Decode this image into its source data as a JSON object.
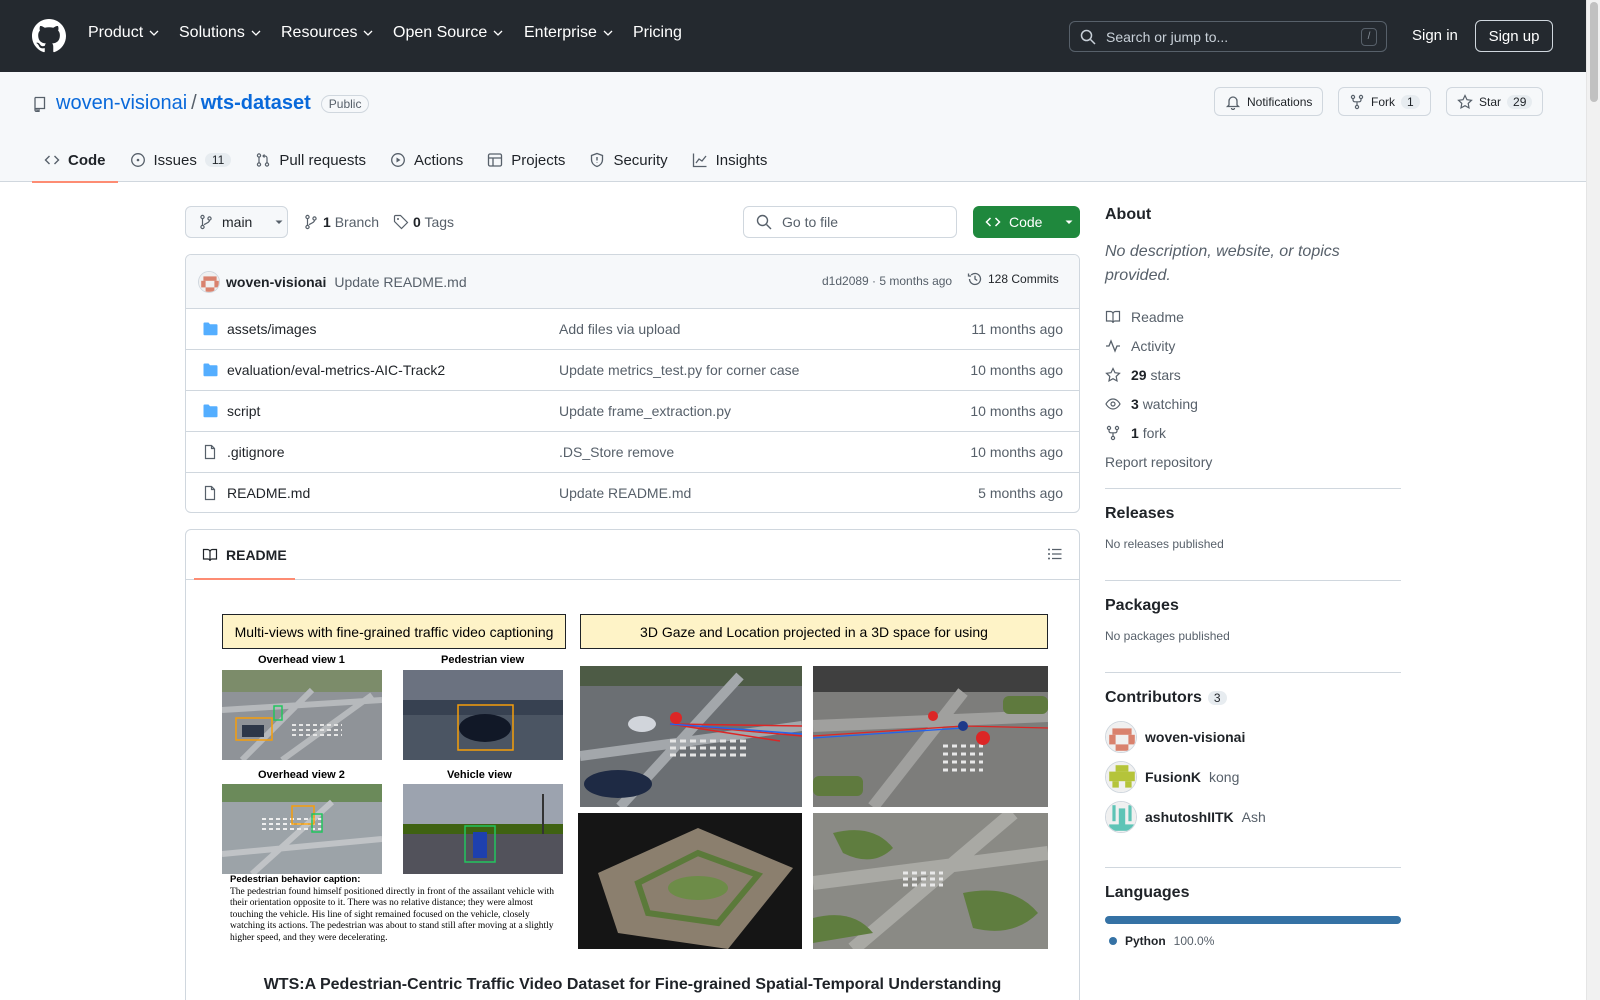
{
  "header": {
    "nav": [
      {
        "label": "Product",
        "dropdown": true
      },
      {
        "label": "Solutions",
        "dropdown": true
      },
      {
        "label": "Resources",
        "dropdown": true
      },
      {
        "label": "Open Source",
        "dropdown": true
      },
      {
        "label": "Enterprise",
        "dropdown": true
      },
      {
        "label": "Pricing",
        "dropdown": false
      }
    ],
    "search_placeholder": "Search or jump to...",
    "search_shortcut": "/",
    "signin": "Sign in",
    "signup": "Sign up"
  },
  "repo": {
    "owner": "woven-visionai",
    "separator": "/",
    "name": "wts-dataset",
    "visibility": "Public",
    "notifications_label": "Notifications",
    "fork_label": "Fork",
    "fork_count": "1",
    "star_label": "Star",
    "star_count": "29"
  },
  "tabs": [
    {
      "label": "Code",
      "icon": "code-icon",
      "active": true
    },
    {
      "label": "Issues",
      "icon": "issue-icon",
      "count": "11"
    },
    {
      "label": "Pull requests",
      "icon": "pull-request-icon"
    },
    {
      "label": "Actions",
      "icon": "play-icon"
    },
    {
      "label": "Projects",
      "icon": "table-icon"
    },
    {
      "label": "Security",
      "icon": "shield-icon"
    },
    {
      "label": "Insights",
      "icon": "graph-icon"
    }
  ],
  "toolbar": {
    "branch": "main",
    "branch_count": "1",
    "branch_label": "Branch",
    "tag_count": "0",
    "tag_label": "Tags",
    "goto_placeholder": "Go to file",
    "code_button": "Code"
  },
  "latest_commit": {
    "author": "woven-visionai",
    "message": "Update README.md",
    "sha_age": "d1d2089 · 5 months ago",
    "commits": "128 Commits"
  },
  "files": [
    {
      "type": "dir",
      "name": "assets/images",
      "message": "Add files via upload",
      "age": "11 months ago"
    },
    {
      "type": "dir",
      "name": "evaluation/eval-metrics-AIC-Track2",
      "message": "Update metrics_test.py for corner case",
      "age": "10 months ago"
    },
    {
      "type": "dir",
      "name": "script",
      "message": "Update frame_extraction.py",
      "age": "10 months ago"
    },
    {
      "type": "file",
      "name": ".gitignore",
      "message": ".DS_Store remove",
      "age": "10 months ago"
    },
    {
      "type": "file",
      "name": "README.md",
      "message": "Update README.md",
      "age": "5 months ago"
    }
  ],
  "readme": {
    "tab_label": "README",
    "figure": {
      "left_caption": "Multi-views with fine-grained traffic video captioning",
      "right_caption": "3D Gaze and Location projected in a 3D space for using",
      "views": [
        "Overhead view 1",
        "Pedestrian view",
        "Overhead view 2",
        "Vehicle view"
      ],
      "behavior_title": "Pedestrian behavior caption:",
      "behavior_text": "The pedestrian found himself positioned directly in front of the assailant vehicle with their orientation opposite to it. There was no relative distance; they were almost touching the vehicle. His line of sight remained focused on the vehicle, closely watching its actions. The pedestrian was about to stand still after moving at a slightly higher speed, and they were decelerating."
    },
    "title": "WTS:A Pedestrian-Centric Traffic Video Dataset for Fine-grained Spatial-Temporal Understanding"
  },
  "sidebar": {
    "about_heading": "About",
    "about_desc": "No description, website, or topics provided.",
    "links": [
      {
        "icon": "book-icon",
        "strong": "",
        "label": "Readme"
      },
      {
        "icon": "pulse-icon",
        "strong": "",
        "label": "Activity"
      },
      {
        "icon": "star-icon",
        "strong": "29",
        "label": "stars"
      },
      {
        "icon": "eye-icon",
        "strong": "3",
        "label": "watching"
      },
      {
        "icon": "fork-icon",
        "strong": "1",
        "label": "fork"
      }
    ],
    "report": "Report repository",
    "releases_heading": "Releases",
    "releases_text": "No releases published",
    "packages_heading": "Packages",
    "packages_text": "No packages published",
    "contributors_heading": "Contributors",
    "contributors_count": "3",
    "contributors": [
      {
        "login": "woven-visionai",
        "name": "",
        "color": "#d9826e"
      },
      {
        "login": "FusionK",
        "name": "kong",
        "color": "#b5c43a"
      },
      {
        "login": "ashutoshIITK",
        "name": "Ash",
        "color": "#5ec4b6"
      }
    ],
    "languages_heading": "Languages",
    "language": {
      "name": "Python",
      "percent": "100.0%",
      "color": "#3572a5"
    }
  }
}
